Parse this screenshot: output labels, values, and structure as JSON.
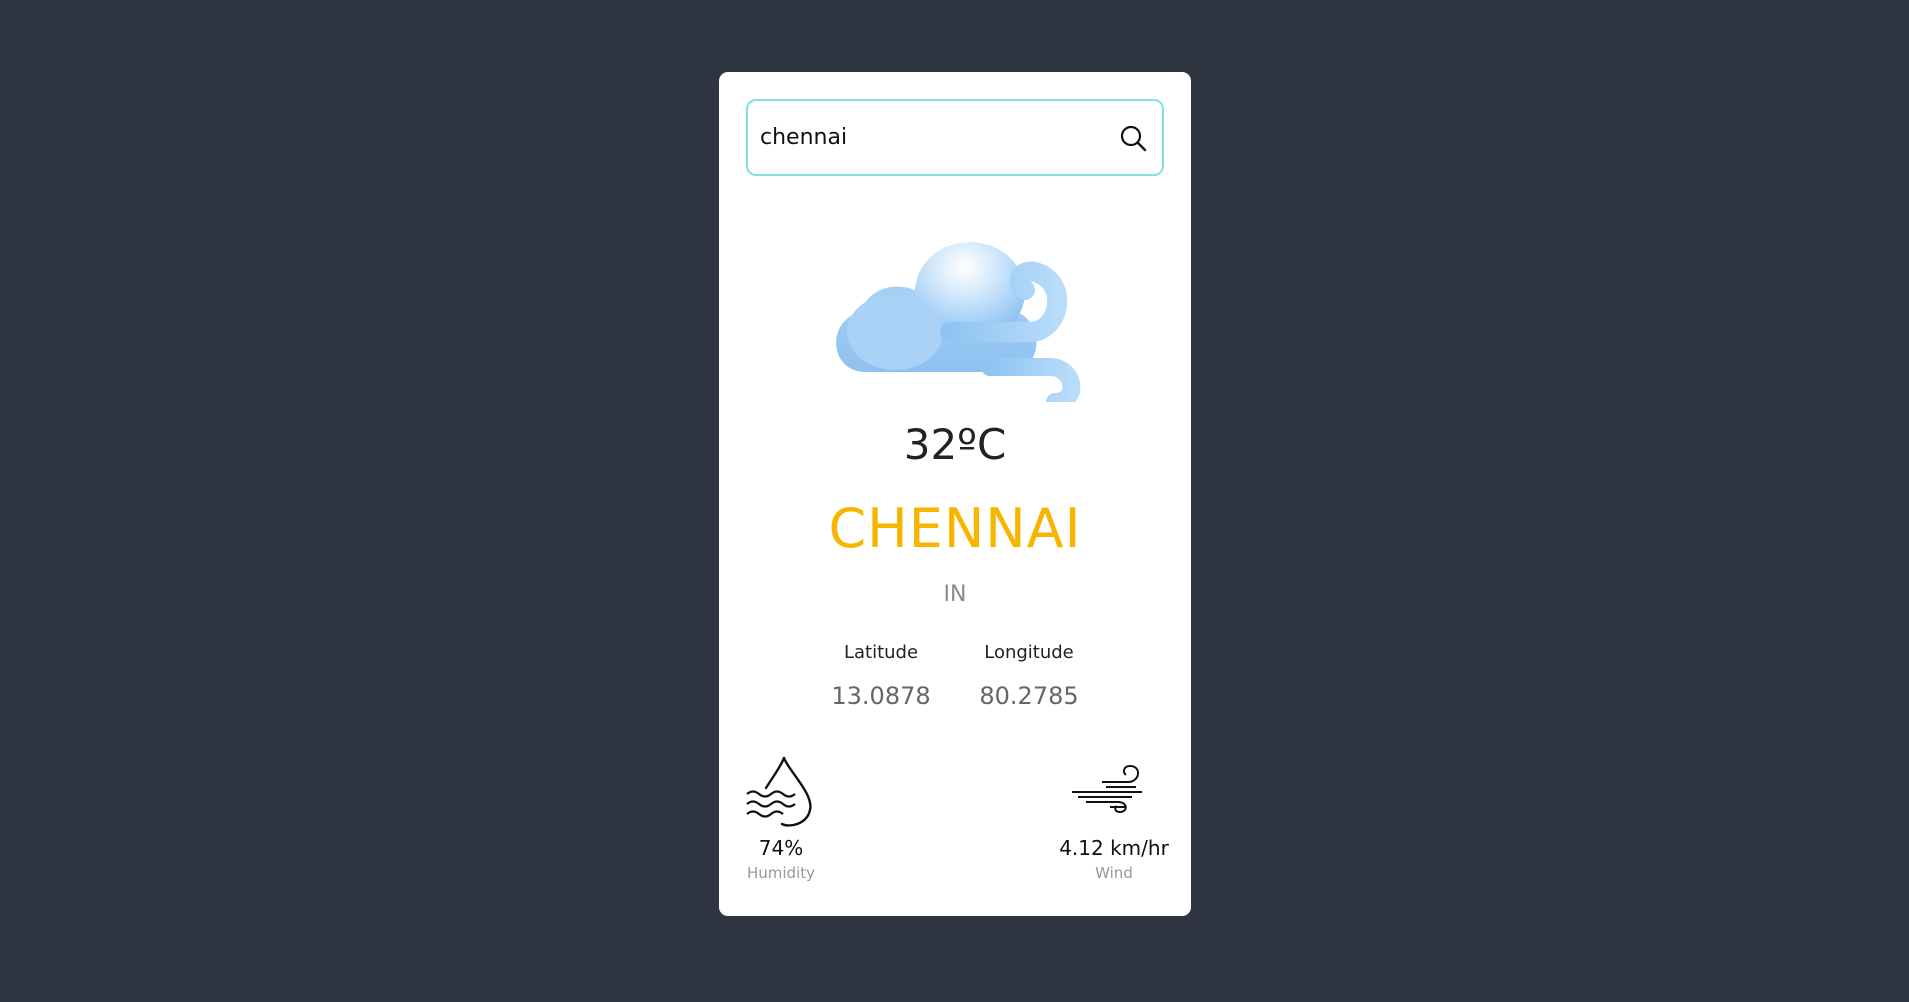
{
  "search": {
    "value": "chennai",
    "placeholder": "Search"
  },
  "weather": {
    "icon": "windy-cloud-icon",
    "temperature": "32ºC",
    "city": "CHENNAI",
    "country": "IN"
  },
  "coordinates": {
    "latitude_label": "Latitude",
    "latitude_value": "13.0878",
    "longitude_label": "Longitude",
    "longitude_value": "80.2785"
  },
  "stats": {
    "humidity_value": "74%",
    "humidity_label": "Humidity",
    "wind_value": "4.12 km/hr",
    "wind_label": "Wind"
  },
  "colors": {
    "background": "#2f3540",
    "card": "#ffffff",
    "accent_border": "#7fe3e6",
    "city": "#f7b500"
  }
}
